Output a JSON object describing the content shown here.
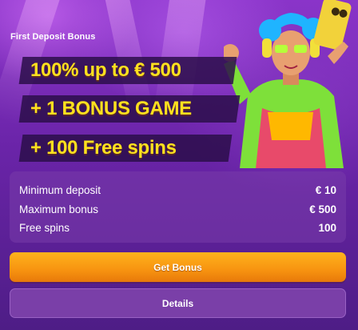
{
  "bonus": {
    "title": "First Deposit Bonus",
    "lines": [
      "100% up to € 500",
      "+ 1 BONUS GAME",
      "+ 100 Free spins"
    ]
  },
  "details_table": [
    {
      "label": "Minimum deposit",
      "value": "€ 10"
    },
    {
      "label": "Maximum bonus",
      "value": "€ 500"
    },
    {
      "label": "Free spins",
      "value": "100"
    }
  ],
  "buttons": {
    "get_bonus": "Get Bonus",
    "details": "Details"
  },
  "colors": {
    "accent_yellow": "#ffe11e",
    "button_orange": "#f79310",
    "background_purple": "#5a1f8f"
  },
  "icons": {
    "character": "dj-girl-selfie-illustration"
  }
}
